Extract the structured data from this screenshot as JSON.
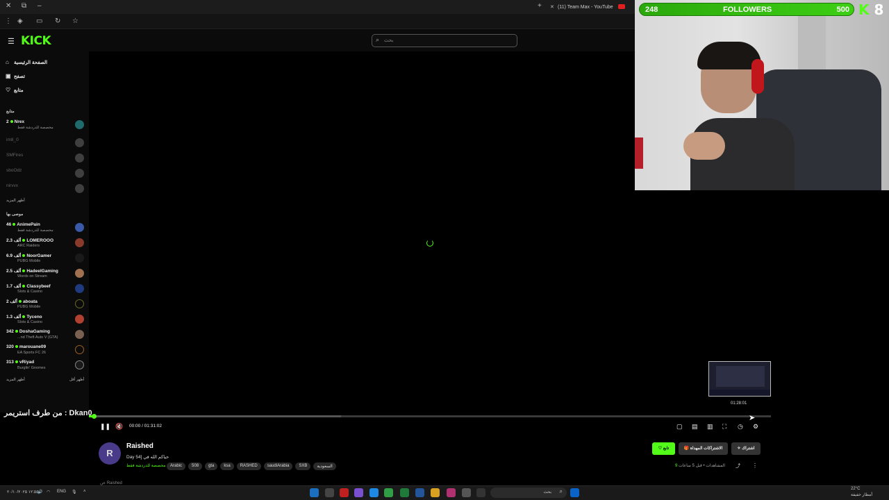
{
  "browser": {
    "tab_title": "(11) Team Max - YouTube",
    "new_tab": "+"
  },
  "header": {
    "logo": "KICK",
    "search_placeholder": "بحث"
  },
  "sidebar": {
    "nav": [
      {
        "label": "الصفحة الرئيسية",
        "icon": "home-icon"
      },
      {
        "label": "تصفح",
        "icon": "browse-icon"
      },
      {
        "label": "متابع",
        "icon": "heart-icon"
      }
    ],
    "following_header": "متابع",
    "following": [
      {
        "name": "Nrex",
        "viewers": "2",
        "category": "مخصصة للدردشة فقط",
        "online": true
      },
      {
        "name": "im8_0",
        "online": false
      },
      {
        "name": "SMFires",
        "online": false
      },
      {
        "name": "sboOdz",
        "online": false
      },
      {
        "name": "nirvvx",
        "online": false
      }
    ],
    "show_more": "أظهر المزيد",
    "recommended_header": "موصى بها",
    "recommended": [
      {
        "name": "AnimePain",
        "viewers": "46",
        "category": "مخصصة للدردشة فقط"
      },
      {
        "name": "LOMEROOO",
        "viewers": "2.3 ألف",
        "category": "ARC Raiders"
      },
      {
        "name": "NoorGamer",
        "viewers": "6.9 ألف",
        "category": "PUBG Mobile"
      },
      {
        "name": "HadeelGaming",
        "viewers": "2.5 ألف",
        "category": "Words on Stream"
      },
      {
        "name": "Classybeef",
        "viewers": "1.7 ألف",
        "category": "Slots & Casino"
      },
      {
        "name": "aboata",
        "viewers": "2 ألف",
        "category": "PUBG Mobile"
      },
      {
        "name": "Tyceno",
        "viewers": "1.3 ألف",
        "category": "Slots & Casino"
      },
      {
        "name": "DoshaGaming",
        "viewers": "342",
        "category": "...nd Theft Auto V (GTA)"
      },
      {
        "name": "marouane09",
        "viewers": "320",
        "category": "EA Sports FC 26"
      },
      {
        "name": "vRiyad",
        "viewers": "313",
        "category": "Burglin' Gnomes"
      }
    ],
    "show_more_2": "أظهر المزيد",
    "show_less": "أظهر أقل"
  },
  "player": {
    "chat_overlay": "من طرف استريمر : Dkan0",
    "preview_time": "01:28:01",
    "current_time": "00:00",
    "duration": "01:31:02",
    "time_display": "00:00 / 01:31:02",
    "played_fraction": 0.006,
    "buffered_fraction": 0.37
  },
  "stream": {
    "streamer": "Raished",
    "title": "Day 54] حياكم الله في",
    "category": "مخصصة للدردشة فقط",
    "tags": [
      "Arabic",
      "508",
      "gta",
      "ksa",
      "RASHED",
      "saudiArabia",
      "SXB",
      "السعودية"
    ],
    "follow_label": "تابع",
    "gift_label": "الاشتراكات المهداة",
    "subscribe_label": "اشتراك",
    "views": "9",
    "views_label": "المشاهدات",
    "age": "قبل 5 ساعات",
    "below_text": "عن Raished"
  },
  "overlay": {
    "followers_count": "248",
    "followers_label": "FOLLOWERS",
    "followers_goal": "500",
    "followers_fraction": 0.496,
    "brand_letter": "K",
    "brand_number": "8"
  },
  "taskbar": {
    "language": "ENG",
    "search_placeholder": "بحث",
    "weather_temp": "22°C",
    "weather_desc": "أمطار خفيفة",
    "clock_time": "١٢:٥٥",
    "clock_date": "٢٠/١٠/٢٠٢٥"
  },
  "colors": {
    "accent": "#53fc18",
    "background": "#000000",
    "sidebar": "#0b0b0c"
  }
}
